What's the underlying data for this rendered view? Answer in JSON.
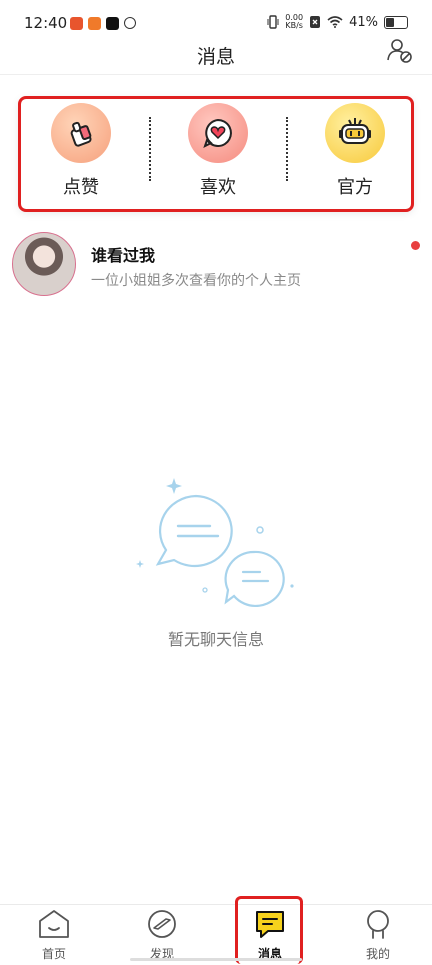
{
  "status_bar": {
    "time": "12:40",
    "net_speed_value": "0.00",
    "net_speed_unit": "KB/s",
    "battery": "41%"
  },
  "header": {
    "title": "消息"
  },
  "quick_actions": [
    {
      "label": "点赞",
      "icon": "thumbs-up-icon",
      "color": "#f6a07c"
    },
    {
      "label": "喜欢",
      "icon": "heart-chat-icon",
      "color": "#f58a7e"
    },
    {
      "label": "官方",
      "icon": "robot-icon",
      "color": "#f8c93a"
    }
  ],
  "visitors": {
    "title": "谁看过我",
    "subtitle": "一位小姐姐多次查看你的个人主页"
  },
  "empty_state": {
    "text": "暂无聊天信息"
  },
  "tabbar": {
    "items": [
      {
        "label": "首页",
        "icon": "home-icon"
      },
      {
        "label": "发现",
        "icon": "discover-icon"
      },
      {
        "label": "消息",
        "icon": "message-icon"
      },
      {
        "label": "我的",
        "icon": "profile-icon"
      }
    ],
    "active": "消息",
    "accent": "#f6d21d"
  }
}
